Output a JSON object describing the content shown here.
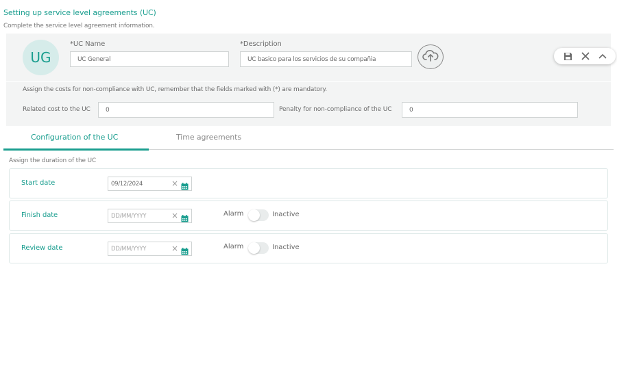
{
  "page": {
    "title": "Setting up service level agreements (UC)",
    "subtitle": "Complete the service level agreement information."
  },
  "header": {
    "avatar_initials": "UG",
    "uc_name_label": "*UC Name",
    "uc_name_value": "UC General",
    "description_label": "*Description",
    "description_value": "UC basico para los servicios de su compañia",
    "upload_icon": "cloud-upload-icon",
    "actions": [
      "save-icon",
      "close-icon",
      "chevron-up-icon"
    ]
  },
  "costs": {
    "note": "Assign the costs for non-compliance with UC, remember that the fields marked with (*) are mandatory.",
    "related_cost_label": "Related cost to the UC",
    "related_cost_value": "0",
    "penalty_label": "Penalty for non-compliance of the UC",
    "penalty_value": "0"
  },
  "tabs": [
    {
      "label": "Configuration of the UC",
      "active": true
    },
    {
      "label": "Time agreements",
      "active": false
    }
  ],
  "duration": {
    "section_label": "Assign the duration of the UC",
    "rows": [
      {
        "label": "Start date",
        "value": "09/12/2024",
        "placeholder": "DD/MM/YYYY",
        "has_alarm": false
      },
      {
        "label": "Finish date",
        "value": "",
        "placeholder": "DD/MM/YYYY",
        "has_alarm": true,
        "alarm_label": "Alarm",
        "alarm_state": "Inactive"
      },
      {
        "label": "Review date",
        "value": "",
        "placeholder": "DD/MM/YYYY",
        "has_alarm": true,
        "alarm_label": "Alarm",
        "alarm_state": "Inactive"
      }
    ]
  },
  "colors": {
    "accent": "#1a9e8f",
    "panel_bg": "#f3f4f4",
    "avatar_bg": "#d6ecea"
  }
}
